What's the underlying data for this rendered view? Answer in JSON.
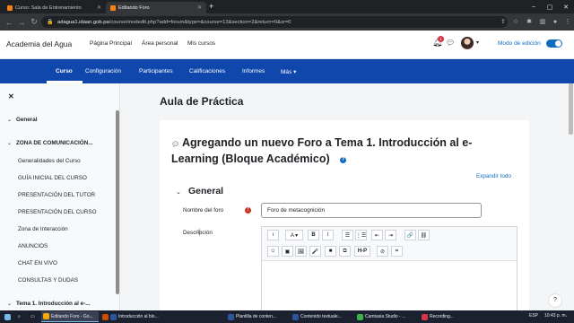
{
  "browser": {
    "tabs": [
      {
        "label": "Curso: Sala de Entrenamiento",
        "active": false
      },
      {
        "label": "Editando Foro",
        "active": true
      }
    ],
    "new_tab_label": "+",
    "url_host": "adagua1.idaan.gob.pa",
    "url_path": "/course/modedit.php?add=forum&type=&course=13&section=2&return=0&sr=0"
  },
  "topnav": {
    "brand": "Academia del Agua",
    "links": [
      "Página Principal",
      "Área personal",
      "Mis cursos"
    ],
    "notification_count": "1",
    "edit_mode_label": "Modo de edición"
  },
  "course_nav": {
    "items": [
      "Curso",
      "Configuración",
      "Participantes",
      "Calificaciones",
      "Informes",
      "Más ▾"
    ],
    "active_index": 0
  },
  "course_index": {
    "sections": [
      {
        "label": "General",
        "items": []
      },
      {
        "label": "ZONA DE COMUNICACIÓN...",
        "items": [
          "Generalidades del Curso",
          "GUÍA INICIAL DEL CURSO",
          "PRESENTACIÓN DEL TUTOR",
          "PRESENTACIÓN DEL CURSO",
          "Zona de Interacción",
          "ANUNCIOS",
          "CHAT EN VIVO",
          "CONSULTAS Y DUDAS"
        ]
      },
      {
        "label": "Tema 1. Introducción al e-...",
        "items": []
      }
    ]
  },
  "page": {
    "title": "Aula de Práctica",
    "heading": "Agregando un nuevo Foro a Tema 1. Introducción al e-Learning (Bloque Académico)",
    "expand_all": "Expandir todo",
    "fieldset_title": "General",
    "forum_name_label": "Nombre del foro",
    "forum_name_value": "Foro de metacognición",
    "description_label": "Descripción"
  },
  "editor_toolbar": {
    "row1": [
      "ı",
      "A ▾",
      "B",
      "I",
      "☰",
      "⋮☰",
      "⇤",
      "⇥",
      "🔗",
      "⛓"
    ],
    "row2": [
      "☺",
      "▣",
      "🖼",
      "🎤",
      "■",
      "⧉",
      "H-P",
      "⊘",
      "⌗"
    ]
  },
  "taskbar": {
    "apps": [
      {
        "label": "Editando Foro - Go...",
        "color": "#f9ab00",
        "active": true
      },
      {
        "label": "",
        "color": "#d04a02",
        "active": false
      },
      {
        "label": "Introducción al blo...",
        "color": "#2b579a",
        "active": false
      },
      {
        "label": "Plantilla de conten...",
        "color": "#2b579a",
        "active": false
      },
      {
        "label": "Contenido textuale...",
        "color": "#2b579a",
        "active": false
      },
      {
        "label": "Camtasia Studio - ...",
        "color": "#3bb54a",
        "active": false
      },
      {
        "label": "Recording...",
        "color": "#d63447",
        "active": false
      }
    ],
    "lang": "ESP",
    "time": "10:43 p. m."
  }
}
